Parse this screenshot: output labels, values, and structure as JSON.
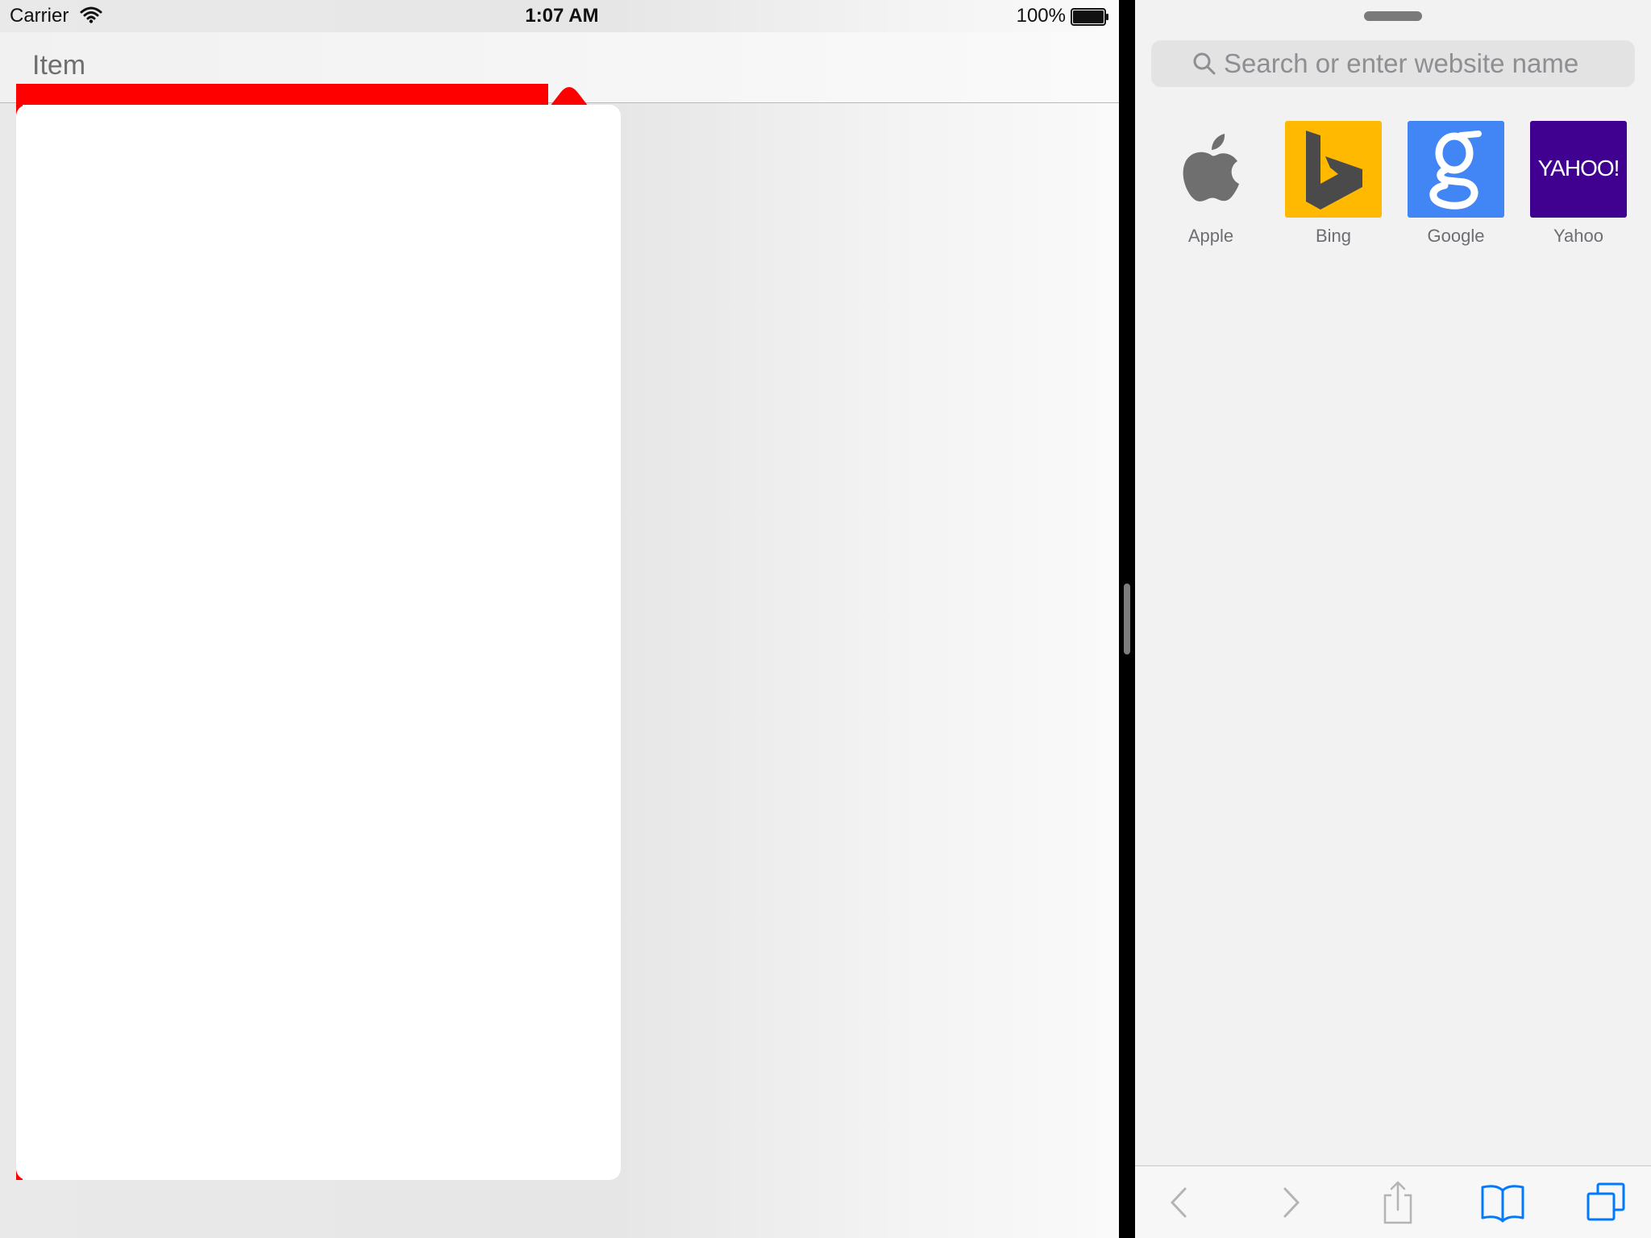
{
  "status_bar": {
    "carrier": "Carrier",
    "time": "1:07 AM",
    "battery_percent": "100%",
    "battery_level": 1.0
  },
  "left_app": {
    "tab_item_label": "Item",
    "accent_color": "#ff0000",
    "popover_color": "#ffffff"
  },
  "safari": {
    "search_placeholder": "Search or enter website name",
    "favorites": [
      {
        "label": "Apple",
        "icon": "apple-icon",
        "color": "#f2f2f2"
      },
      {
        "label": "Bing",
        "icon": "bing-icon",
        "color": "#ffb900"
      },
      {
        "label": "Google",
        "icon": "google-icon",
        "color": "#4285f4"
      },
      {
        "label": "Yahoo",
        "icon": "yahoo-icon",
        "color": "#400090",
        "logo_text": "YAHOO!"
      }
    ],
    "toolbar": {
      "icons": [
        "back-arrow-icon",
        "forward-arrow-icon",
        "share-icon",
        "bookmarks-icon",
        "tabs-icon"
      ],
      "active_color": "#007aff",
      "disabled_color": "#b4b4b4"
    }
  }
}
